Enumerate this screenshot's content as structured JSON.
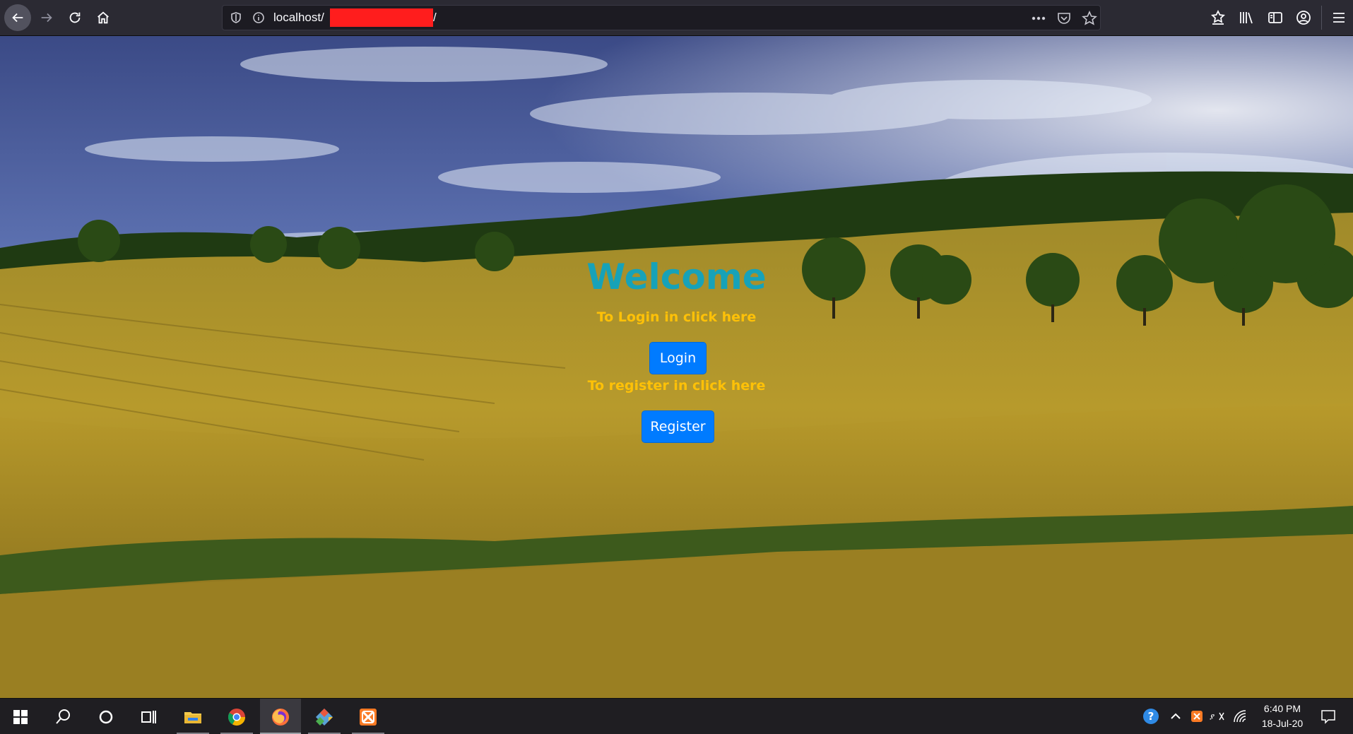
{
  "browser": {
    "url_host": "localhost/",
    "url_trailing": "/",
    "icons": {
      "back": "back-arrow-icon",
      "forward": "forward-arrow-icon",
      "reload": "reload-icon",
      "home": "home-icon",
      "shield": "tracking-protection-shield-icon",
      "info": "site-info-icon",
      "more": "page-actions-more-icon",
      "pocket": "pocket-icon",
      "bookmark": "bookmark-star-icon",
      "collections": "collections-icon",
      "library": "library-icon",
      "sidebar": "sidebar-icon",
      "account": "account-icon",
      "menu": "hamburger-menu-icon"
    }
  },
  "page": {
    "heading": "Welcome",
    "login_prompt": "To Login in click here",
    "login_button": "Login",
    "register_prompt": "To register in click here",
    "register_button": "Register",
    "colors": {
      "heading": "#17a2b8",
      "prompt": "#ffc107",
      "button": "#007bff"
    }
  },
  "taskbar": {
    "apps": [
      "windows-start-icon",
      "search-icon",
      "cortana-icon",
      "task-view-icon",
      "file-explorer-icon",
      "chrome-icon",
      "firefox-icon",
      "git-icon",
      "xampp-icon"
    ],
    "active_app": "firefox-icon",
    "tray": [
      "help-icon",
      "show-hidden-icons-chevron",
      "xampp-tray-icon",
      "input-method-icon",
      "network-icon",
      "notification-icon"
    ],
    "time": "6:40 PM",
    "date": "18-Jul-20"
  }
}
